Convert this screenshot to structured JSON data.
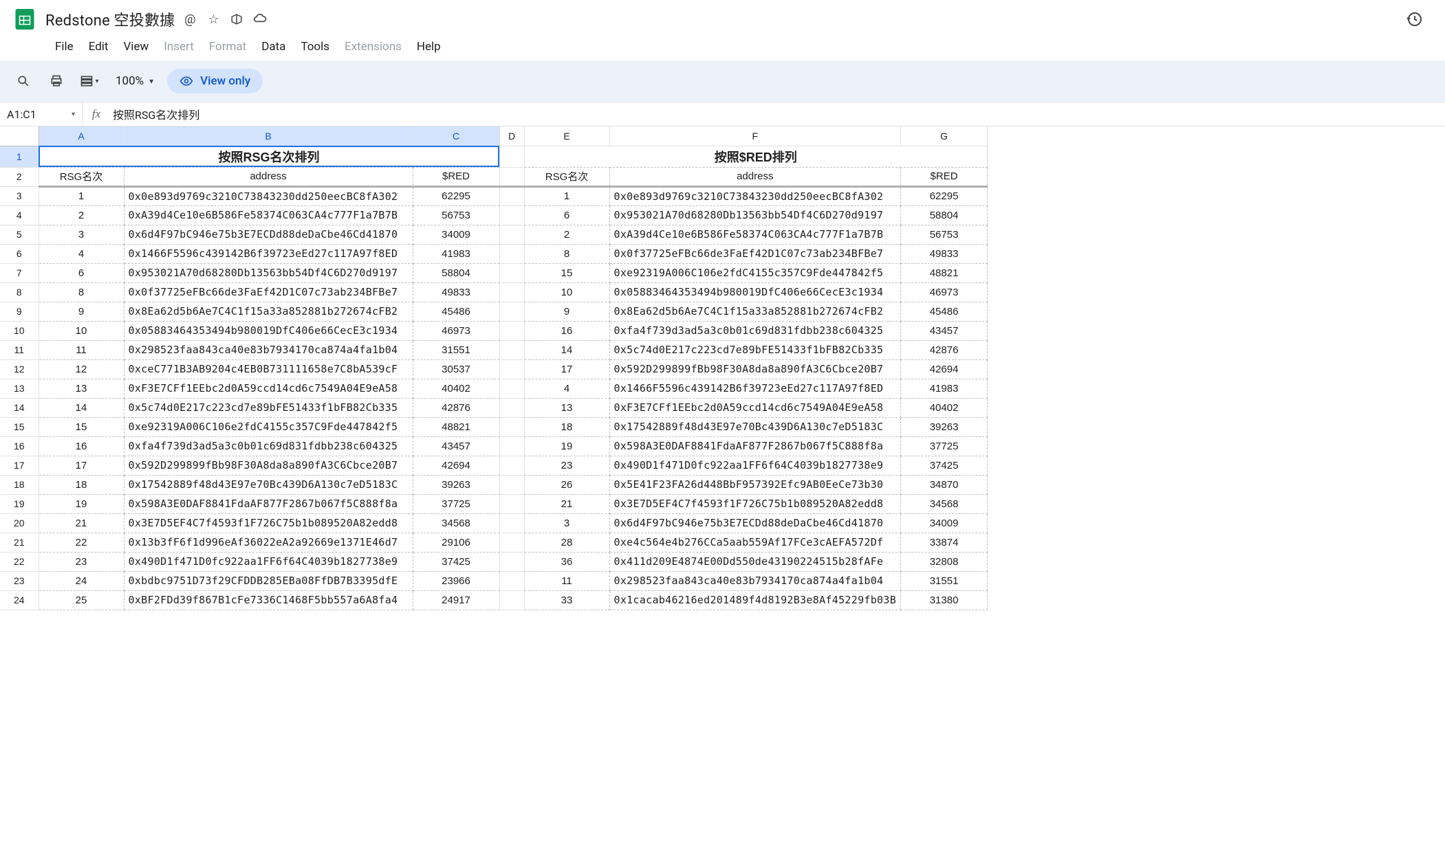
{
  "doc": {
    "title": "Redstone 空投數據"
  },
  "menu": {
    "file": "File",
    "edit": "Edit",
    "view": "View",
    "insert": "Insert",
    "format": "Format",
    "data": "Data",
    "tools": "Tools",
    "extensions": "Extensions",
    "help": "Help"
  },
  "toolbar": {
    "zoom": "100%",
    "view_only": "View only"
  },
  "formula": {
    "namebox": "A1:C1",
    "value": "按照RSG名次排列"
  },
  "columns": [
    "A",
    "B",
    "C",
    "D",
    "E",
    "F",
    "G"
  ],
  "selected_cols": [
    "A",
    "B",
    "C"
  ],
  "row_count": 24,
  "titles": {
    "left": "按照RSG名次排列",
    "right": "按照$RED排列"
  },
  "headers": {
    "rank": "RSG名次",
    "address": "address",
    "red": "$RED"
  },
  "left_rows": [
    {
      "rank": "1",
      "addr": "0x0e893d9769c3210C73843230dd250eecBC8fA302",
      "red": "62295"
    },
    {
      "rank": "2",
      "addr": "0xA39d4Ce10e6B586Fe58374C063CA4c777F1a7B7B",
      "red": "56753"
    },
    {
      "rank": "3",
      "addr": "0x6d4F97bC946e75b3E7ECDd88deDaCbe46Cd41870",
      "red": "34009"
    },
    {
      "rank": "4",
      "addr": "0x1466F5596c439142B6f39723eEd27c117A97f8ED",
      "red": "41983"
    },
    {
      "rank": "6",
      "addr": "0x953021A70d68280Db13563bb54Df4C6D270d9197",
      "red": "58804"
    },
    {
      "rank": "8",
      "addr": "0x0f37725eFBc66de3FaEf42D1C07c73ab234BFBe7",
      "red": "49833"
    },
    {
      "rank": "9",
      "addr": "0x8Ea62d5b6Ae7C4C1f15a33a852881b272674cFB2",
      "red": "45486"
    },
    {
      "rank": "10",
      "addr": "0x05883464353494b980019DfC406e66CecE3c1934",
      "red": "46973"
    },
    {
      "rank": "11",
      "addr": "0x298523faa843ca40e83b7934170ca874a4fa1b04",
      "red": "31551"
    },
    {
      "rank": "12",
      "addr": "0xceC771B3AB9204c4EB0B731111658e7C8bA539cF",
      "red": "30537"
    },
    {
      "rank": "13",
      "addr": "0xF3E7CFf1EEbc2d0A59ccd14cd6c7549A04E9eA58",
      "red": "40402"
    },
    {
      "rank": "14",
      "addr": "0x5c74d0E217c223cd7e89bFE51433f1bFB82Cb335",
      "red": "42876"
    },
    {
      "rank": "15",
      "addr": "0xe92319A006C106e2fdC4155c357C9Fde447842f5",
      "red": "48821"
    },
    {
      "rank": "16",
      "addr": "0xfa4f739d3ad5a3c0b01c69d831fdbb238c604325",
      "red": "43457"
    },
    {
      "rank": "17",
      "addr": "0x592D299899fBb98F30A8da8a890fA3C6Cbce20B7",
      "red": "42694"
    },
    {
      "rank": "18",
      "addr": "0x17542889f48d43E97e70Bc439D6A130c7eD5183C",
      "red": "39263"
    },
    {
      "rank": "19",
      "addr": "0x598A3E0DAF8841FdaAF877F2867b067f5C888f8a",
      "red": "37725"
    },
    {
      "rank": "21",
      "addr": "0x3E7D5EF4C7f4593f1F726C75b1b089520A82edd8",
      "red": "34568"
    },
    {
      "rank": "22",
      "addr": "0x13b3fF6f1d996eAf36022eA2a92669e1371E46d7",
      "red": "29106"
    },
    {
      "rank": "23",
      "addr": "0x490D1f471D0fc922aa1FF6f64C4039b1827738e9",
      "red": "37425"
    },
    {
      "rank": "24",
      "addr": "0xbdbc9751D73f29CFDDB285EBa08FfDB7B3395dfE",
      "red": "23966"
    },
    {
      "rank": "25",
      "addr": "0xBF2FDd39f867B1cFe7336C1468F5bb557a6A8fa4",
      "red": "24917"
    }
  ],
  "right_rows": [
    {
      "rank": "1",
      "addr": "0x0e893d9769c3210C73843230dd250eecBC8fA302",
      "red": "62295"
    },
    {
      "rank": "6",
      "addr": "0x953021A70d68280Db13563bb54Df4C6D270d9197",
      "red": "58804"
    },
    {
      "rank": "2",
      "addr": "0xA39d4Ce10e6B586Fe58374C063CA4c777F1a7B7B",
      "red": "56753"
    },
    {
      "rank": "8",
      "addr": "0x0f37725eFBc66de3FaEf42D1C07c73ab234BFBe7",
      "red": "49833"
    },
    {
      "rank": "15",
      "addr": "0xe92319A006C106e2fdC4155c357C9Fde447842f5",
      "red": "48821"
    },
    {
      "rank": "10",
      "addr": "0x05883464353494b980019DfC406e66CecE3c1934",
      "red": "46973"
    },
    {
      "rank": "9",
      "addr": "0x8Ea62d5b6Ae7C4C1f15a33a852881b272674cFB2",
      "red": "45486"
    },
    {
      "rank": "16",
      "addr": "0xfa4f739d3ad5a3c0b01c69d831fdbb238c604325",
      "red": "43457"
    },
    {
      "rank": "14",
      "addr": "0x5c74d0E217c223cd7e89bFE51433f1bFB82Cb335",
      "red": "42876"
    },
    {
      "rank": "17",
      "addr": "0x592D299899fBb98F30A8da8a890fA3C6Cbce20B7",
      "red": "42694"
    },
    {
      "rank": "4",
      "addr": "0x1466F5596c439142B6f39723eEd27c117A97f8ED",
      "red": "41983"
    },
    {
      "rank": "13",
      "addr": "0xF3E7CFf1EEbc2d0A59ccd14cd6c7549A04E9eA58",
      "red": "40402"
    },
    {
      "rank": "18",
      "addr": "0x17542889f48d43E97e70Bc439D6A130c7eD5183C",
      "red": "39263"
    },
    {
      "rank": "19",
      "addr": "0x598A3E0DAF8841FdaAF877F2867b067f5C888f8a",
      "red": "37725"
    },
    {
      "rank": "23",
      "addr": "0x490D1f471D0fc922aa1FF6f64C4039b1827738e9",
      "red": "37425"
    },
    {
      "rank": "26",
      "addr": "0x5E41F23FA26d448BbF957392Efc9AB0EeCe73b30",
      "red": "34870"
    },
    {
      "rank": "21",
      "addr": "0x3E7D5EF4C7f4593f1F726C75b1b089520A82edd8",
      "red": "34568"
    },
    {
      "rank": "3",
      "addr": "0x6d4F97bC946e75b3E7ECDd88deDaCbe46Cd41870",
      "red": "34009"
    },
    {
      "rank": "28",
      "addr": "0xe4c564e4b276CCa5aab559Af17FCe3cAEFA572Df",
      "red": "33874"
    },
    {
      "rank": "36",
      "addr": "0x411d209E4874E00Dd550de43190224515b28fAFe",
      "red": "32808"
    },
    {
      "rank": "11",
      "addr": "0x298523faa843ca40e83b7934170ca874a4fa1b04",
      "red": "31551"
    },
    {
      "rank": "33",
      "addr": "0x1cacab46216ed201489f4d8192B3e8Af45229fb03B",
      "red": "31380"
    }
  ]
}
